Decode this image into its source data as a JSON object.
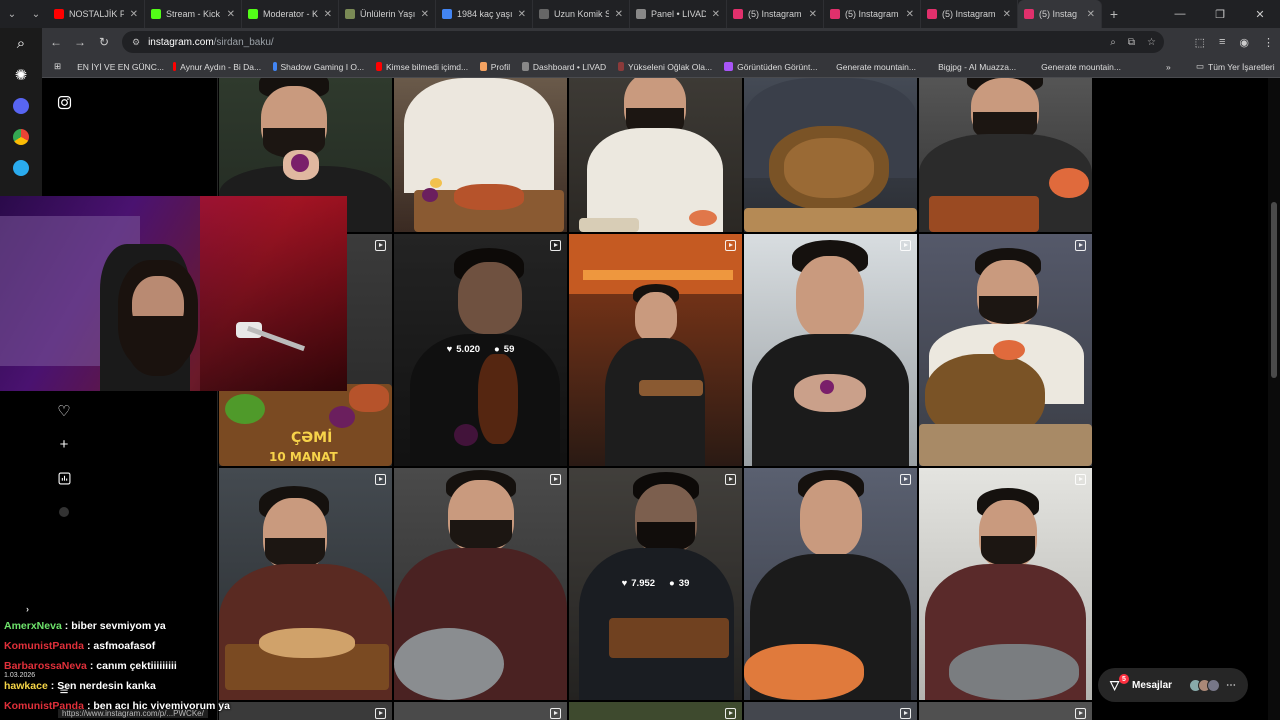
{
  "browser": {
    "tabs": [
      {
        "title": "NOSTALJİK Pl",
        "color": "#ff0000"
      },
      {
        "title": "Stream - Kick",
        "color": "#53fc18"
      },
      {
        "title": "Moderator - K",
        "color": "#53fc18"
      },
      {
        "title": "Ünlülerin Yaşı",
        "color": "#7a8a55"
      },
      {
        "title": "1984 kaç yaşın",
        "color": "#4285f4"
      },
      {
        "title": "Uzun Komik S",
        "color": "#666666"
      },
      {
        "title": "Panel • LIVAD",
        "color": "#888888"
      },
      {
        "title": "(5) Instagram",
        "color": "#e1306c"
      },
      {
        "title": "(5) Instagram",
        "color": "#e1306c"
      },
      {
        "title": "(5) Instagram",
        "color": "#e1306c"
      },
      {
        "title": "(5) Instag",
        "color": "#e1306c"
      }
    ],
    "close_glyph": "✕",
    "new_tab": "+",
    "url_host": "instagram.com",
    "url_path": "/sirdan_baku/",
    "bookmarks": [
      {
        "title": "EN İYİ VE EN GÜNC...",
        "color": "#ff0000"
      },
      {
        "title": "Aynur Aydın - Bi Da...",
        "color": "#ff0000"
      },
      {
        "title": "Shadow Gaming I O...",
        "color": "#4285f4"
      },
      {
        "title": "Kimse bilmedi içimd...",
        "color": "#ff0000"
      },
      {
        "title": "Profil",
        "color": "#f4a261"
      },
      {
        "title": "Dashboard • LIVAD",
        "color": "#888888"
      },
      {
        "title": "Yükseleni Oğlak Ola...",
        "color": "#8b3a3a"
      },
      {
        "title": "Görüntüden Görünt...",
        "color": "#a855f7"
      },
      {
        "title": "Generate mountain...",
        "color": ""
      },
      {
        "title": "Bigjpg - AI Muazza...",
        "color": ""
      },
      {
        "title": "Generate mountain...",
        "color": ""
      }
    ],
    "bookmarks_more": "»",
    "all_bookmarks": "Tüm Yer İşaretleri"
  },
  "posts": [
    {
      "likes": "5.020",
      "comments": "59"
    },
    {
      "likes": "7.952",
      "comments": "39"
    }
  ],
  "overlay_text": {
    "cami": "ÇƏMİ",
    "price": "10 MANAT"
  },
  "messages": {
    "label": "Mesajlar",
    "count": "5"
  },
  "chat": [
    {
      "user": "AmerxNeva",
      "user_color": "#6ee36b",
      "message": ": biber sevmiyom ya"
    },
    {
      "user": "KomunistPanda",
      "user_color": "#e0303a",
      "message": ": asfmoafasof"
    },
    {
      "user": "BarbarossaNeva",
      "user_color": "#e0303a",
      "message": ": canım çektiiiiiiiii"
    },
    {
      "user": "hawkace",
      "user_color": "#f5d547",
      "message": ": Sen nerdesin kanka"
    },
    {
      "user": "KomunistPanda",
      "user_color": "#e0303a",
      "message": ": ben acı hiç yiyemiyorum ya"
    }
  ],
  "chat_date": "1.03.2026",
  "status_url": "https://www.instagram.com/p/...PWCKe/"
}
